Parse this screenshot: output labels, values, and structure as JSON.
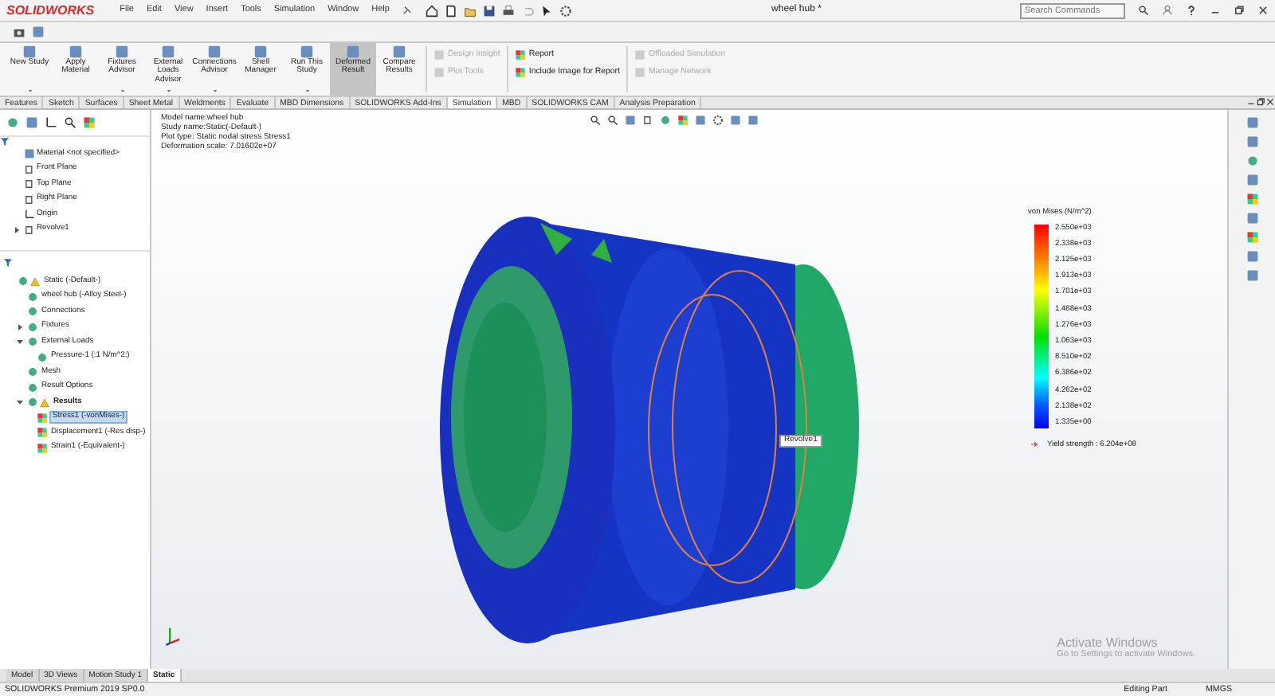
{
  "app": {
    "logo": "SOLIDWORKS",
    "menu": [
      "File",
      "Edit",
      "View",
      "Insert",
      "Tools",
      "Simulation",
      "Window",
      "Help"
    ],
    "title": "wheel hub *",
    "search": {
      "placeholder": "Search Commands"
    }
  },
  "ribbon": {
    "large_buttons": [
      {
        "label": "New Study",
        "selected": false,
        "dropdown": true
      },
      {
        "label": "Apply Material",
        "selected": false,
        "dropdown": false
      },
      {
        "label": "Fixtures Advisor",
        "selected": false,
        "dropdown": true
      },
      {
        "label": "External Loads Advisor",
        "selected": false,
        "dropdown": true
      },
      {
        "label": "Connections Advisor",
        "selected": false,
        "dropdown": true
      },
      {
        "label": "Shell Manager",
        "selected": false,
        "dropdown": false
      },
      {
        "label": "Run This Study",
        "selected": false,
        "dropdown": true
      },
      {
        "label": "Deformed Result",
        "selected": true,
        "dropdown": false
      },
      {
        "label": "Compare Results",
        "selected": false,
        "dropdown": false
      }
    ],
    "small_groups": [
      [
        {
          "label": "Design Insight",
          "disabled": true
        },
        {
          "label": "Plot Tools",
          "disabled": true
        }
      ],
      [
        {
          "label": "Report",
          "disabled": false
        },
        {
          "label": "Include Image for Report",
          "disabled": false
        }
      ],
      [
        {
          "label": "Offloaded Simulation",
          "disabled": true
        },
        {
          "label": "Manage Network",
          "disabled": true
        }
      ]
    ]
  },
  "tabs": [
    {
      "label": "Features",
      "selected": false
    },
    {
      "label": "Sketch",
      "selected": false
    },
    {
      "label": "Surfaces",
      "selected": false
    },
    {
      "label": "Sheet Metal",
      "selected": false
    },
    {
      "label": "Weldments",
      "selected": false
    },
    {
      "label": "Evaluate",
      "selected": false
    },
    {
      "label": "MBD Dimensions",
      "selected": false
    },
    {
      "label": "SOLIDWORKS Add-Ins",
      "selected": false
    },
    {
      "label": "Simulation",
      "selected": true
    },
    {
      "label": "MBD",
      "selected": false
    },
    {
      "label": "SOLIDWORKS CAM",
      "selected": false
    },
    {
      "label": "Analysis Preparation",
      "selected": false
    }
  ],
  "feature_tree": [
    {
      "label": "Material <not specified>"
    },
    {
      "label": "Front Plane"
    },
    {
      "label": "Top Plane"
    },
    {
      "label": "Right Plane"
    },
    {
      "label": "Origin"
    },
    {
      "label": "Revolve1",
      "expanded": false
    }
  ],
  "simulation_tree": [
    {
      "label": "Static (-Default-)",
      "warning": true,
      "selected": false,
      "children": [
        {
          "label": "wheel hub (-Alloy Steel-)",
          "selected": false
        },
        {
          "label": "Connections",
          "selected": false
        },
        {
          "label": "Fixtures",
          "expanded": false,
          "selected": false
        },
        {
          "label": "External Loads",
          "expanded": true,
          "selected": false,
          "children": [
            {
              "label": "Pressure-1 (:1 N/m^2:)",
              "selected": false
            }
          ]
        },
        {
          "label": "Mesh",
          "selected": false
        },
        {
          "label": "Result Options",
          "selected": false
        },
        {
          "label": "Results",
          "expanded": true,
          "warning": true,
          "bold": true,
          "selected": false,
          "children": [
            {
              "label": "Stress1 (-vonMises-)",
              "selected": true
            },
            {
              "label": "Displacement1 (-Res disp-)",
              "selected": false
            },
            {
              "label": "Strain1 (-Equivalent-)",
              "selected": false
            }
          ]
        }
      ]
    }
  ],
  "viewport": {
    "info": [
      "Model name:wheel hub",
      "Study name:Static(-Default-)",
      "Plot type: Static nodal stress Stress1",
      "Deformation scale: 7.01602e+07"
    ],
    "legend": {
      "title": "von Mises (N/m^2)",
      "ticks": [
        "2.550e+03",
        "2.338e+03",
        "2.125e+03",
        "1.913e+03",
        "1.701e+03",
        "1.488e+03",
        "1.276e+03",
        "1.063e+03",
        "8.510e+02",
        "6.386e+02",
        "4.262e+02",
        "2.138e+02",
        "1.335e+00"
      ],
      "yield": "Yield strength : 6.204e+08"
    },
    "tooltip": "Revolve1",
    "watermark_os": {
      "title": "Activate Windows",
      "text": "Go to Settings to activate Windows."
    }
  },
  "bottom_tabs": [
    {
      "label": "Model",
      "selected": false
    },
    {
      "label": "3D Views",
      "selected": false
    },
    {
      "label": "Motion Study 1",
      "selected": false
    },
    {
      "label": "Static",
      "selected": true
    }
  ],
  "status_bar": {
    "product": "SOLIDWORKS Premium 2019 SP0.0",
    "mode": "Editing Part",
    "units": "MMGS"
  }
}
